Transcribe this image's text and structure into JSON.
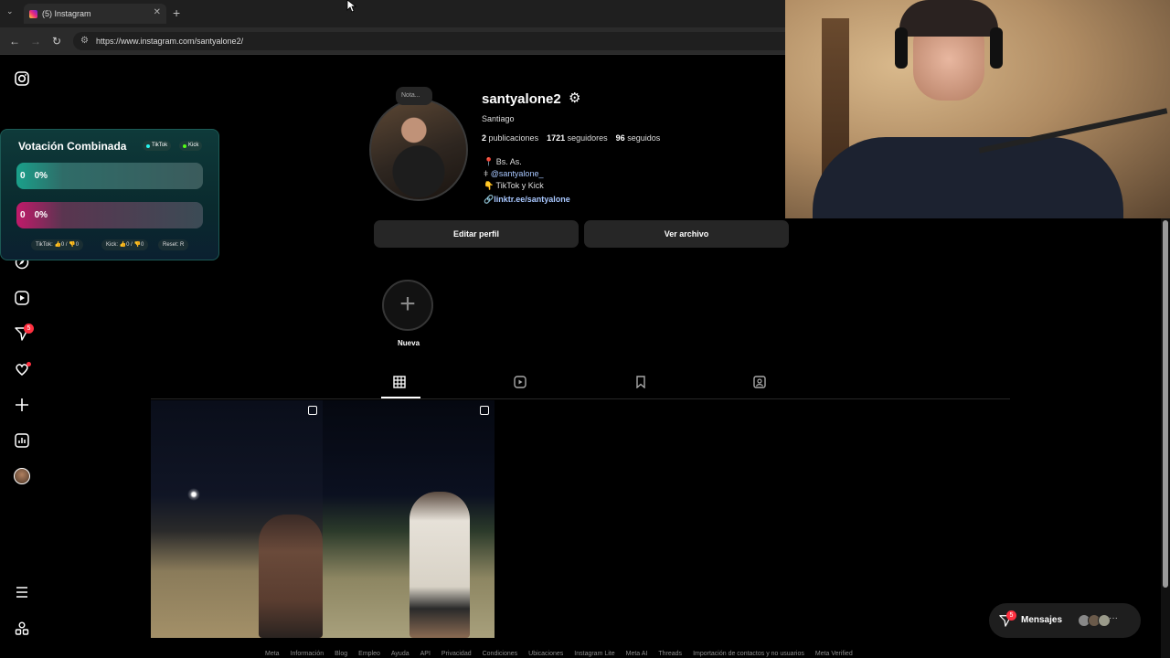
{
  "browser": {
    "tab_title": "(5) Instagram",
    "url": "https://www.instagram.com/santyalone2/"
  },
  "sidebar": {
    "notif_badge": "5"
  },
  "vote_widget": {
    "title": "Votación Combinada",
    "pill_tiktok": "TikTok",
    "pill_kick": "Kick",
    "bar1_count": "0",
    "bar1_pct": "0%",
    "bar2_count": "0",
    "bar2_pct": "0%",
    "stat_tiktok": "TikTok: 👍0 / 👎0",
    "stat_kick": "Kick: 👍0 / 👎0",
    "stat_reset": "Reset: R"
  },
  "profile": {
    "note": "Nota...",
    "username": "santyalone2",
    "full_name": "Santiago",
    "posts_count": "2",
    "posts_label": "publicaciones",
    "followers_count": "1721",
    "followers_label": "seguidores",
    "following_count": "96",
    "following_label": "seguidos",
    "bio_location": "📍 Bs. As.",
    "bio_handle": "@santyalone_",
    "bio_platforms": "👇 TikTok y Kick",
    "bio_link": "linktr.ee/santyalone",
    "edit_button": "Editar perfil",
    "archive_button": "Ver archivo",
    "new_story_label": "Nueva"
  },
  "messages": {
    "label": "Mensajes",
    "badge": "5"
  },
  "footer_links": [
    "Meta",
    "Información",
    "Blog",
    "Empleo",
    "Ayuda",
    "API",
    "Privacidad",
    "Condiciones",
    "Ubicaciones",
    "Instagram Lite",
    "Meta AI",
    "Threads",
    "Importación de contactos y no usuarios",
    "Meta Verified"
  ],
  "colors": {
    "background": "#000000",
    "button_bg": "#262626",
    "link": "#a8c7ff",
    "badge": "#ff3040"
  }
}
